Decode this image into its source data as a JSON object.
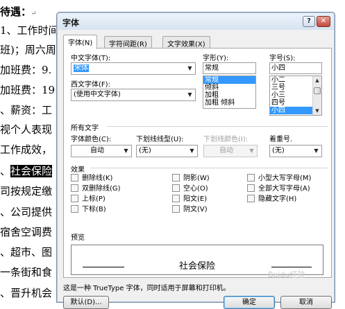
{
  "document": {
    "lines": [
      {
        "text": "待遇：",
        "mark": "↵",
        "bold": true
      },
      {
        "text": "1、工作时间"
      },
      {
        "text": "班)；周六周"
      },
      {
        "text": "加班费：9."
      },
      {
        "text": "加班费：19"
      },
      {
        "text": "、薪资：工"
      },
      {
        "text": "视个人表现"
      },
      {
        "text": "工作成效，"
      },
      {
        "text": "、",
        "highlight": "社会保险"
      },
      {
        "text": "司按规定缴"
      },
      {
        "text": "、公司提供"
      },
      {
        "text": "宿舍空调费"
      },
      {
        "text": "、超市、图"
      },
      {
        "text": "一条街和食"
      },
      {
        "text": "、晋升机会"
      }
    ]
  },
  "dialog": {
    "title": "字体",
    "help_glyph": "?",
    "close_glyph": "✕",
    "tabs": [
      "字体(N)",
      "字符间距(R)",
      "文字效果(X)"
    ],
    "chinese_font": {
      "label": "中文字体(T):",
      "value": "宋体"
    },
    "western_font": {
      "label": "西文字体(F):",
      "value": "(使用中文字体)"
    },
    "style": {
      "label": "字形(Y):",
      "value": "常规",
      "options": [
        "常规",
        "倾斜",
        "加粗",
        "加粗 倾斜"
      ],
      "selected_index": 0
    },
    "size": {
      "label": "字号(S):",
      "value": "小四",
      "options": [
        "小二",
        "三号",
        "小三",
        "四号",
        "小四"
      ],
      "selected_index": 4
    },
    "all_text": {
      "label": "所有文字",
      "font_color": {
        "label": "字体颜色(C):",
        "value": "自动"
      },
      "underline_style": {
        "label": "下划线线型(U):",
        "value": "(无)"
      },
      "underline_color": {
        "label": "下划线颜色(I):",
        "value": "自动"
      },
      "emphasis": {
        "label": "着重号.",
        "value": "(无)"
      }
    },
    "effects": {
      "label": "效果",
      "col1": [
        "删除线(K)",
        "双删除线(G)",
        "上标(P)",
        "下标(B)"
      ],
      "col2": [
        "阴影(W)",
        "空心(O)",
        "阳文(E)",
        "阴文(V)"
      ],
      "col3": [
        "小型大写字母(M)",
        "全部大写字母(A)",
        "隐藏文字(H)"
      ]
    },
    "preview": {
      "label": "预览",
      "text": "社会保险"
    },
    "note": "这是一种 TrueType 字体，同时适用于屏幕和打印机。",
    "buttons": {
      "default": "默认(D)...",
      "ok": "确定",
      "cancel": "取消"
    },
    "watermark": "Baidu经验"
  }
}
